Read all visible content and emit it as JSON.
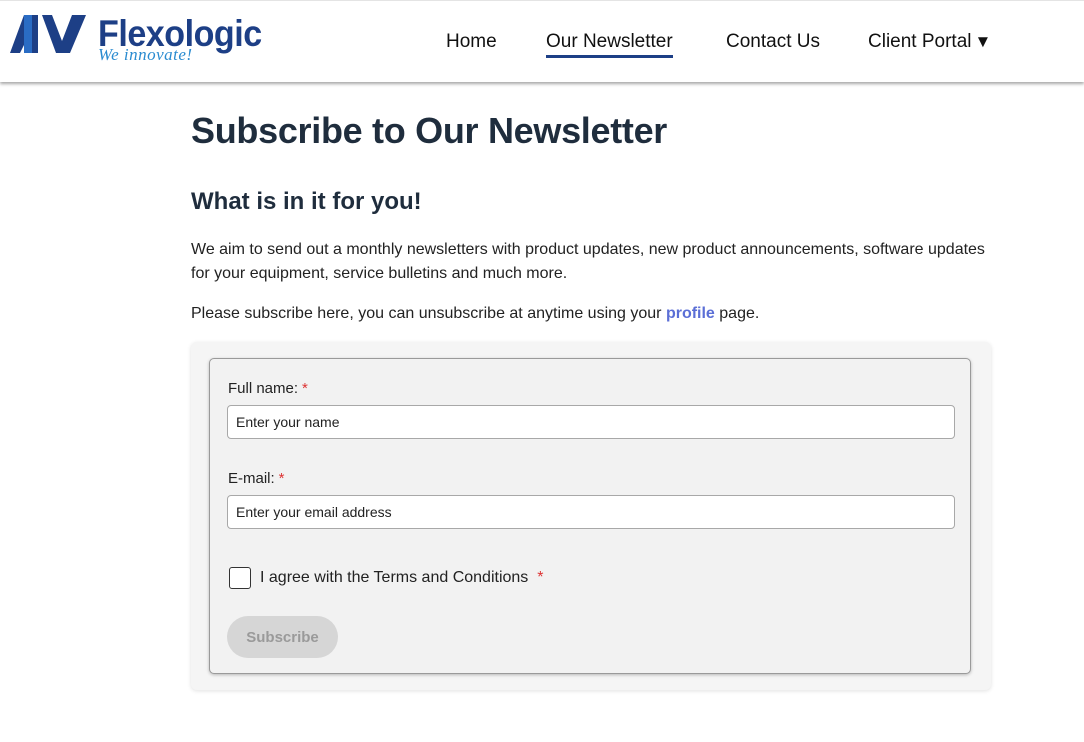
{
  "brand": {
    "name": "Flexologic",
    "tagline": "We innovate!",
    "mark_color": "#1d3f86"
  },
  "nav": {
    "items": [
      {
        "label": "Home"
      },
      {
        "label": "Our Newsletter",
        "active": true
      },
      {
        "label": "Contact Us"
      },
      {
        "label": "Client Portal"
      }
    ],
    "portal_caret": "▼"
  },
  "page": {
    "title": "Subscribe to Our Newsletter",
    "subtitle": "What is in it for you!",
    "intro": "We aim to send out a monthly newsletters with product updates, new product announcements, software updates for your equipment, service bulletins and much more.",
    "note_before": "Please subscribe here, you can unsubscribe at anytime using your ",
    "note_link": "profile",
    "note_after": " page."
  },
  "form": {
    "name_label": "Full name:",
    "name_placeholder": "Enter your name",
    "email_label": "E-mail:",
    "email_placeholder": "Enter your email address",
    "required_mark": "*",
    "terms_label": "I agree with the Terms and Conditions",
    "terms_checked": false,
    "submit_label": "Subscribe",
    "submit_enabled": false
  },
  "colors": {
    "accent": "#1d3f86",
    "link": "#5b6fd6",
    "required": "#dd3333",
    "button_disabled_bg": "#d6d6d6"
  }
}
